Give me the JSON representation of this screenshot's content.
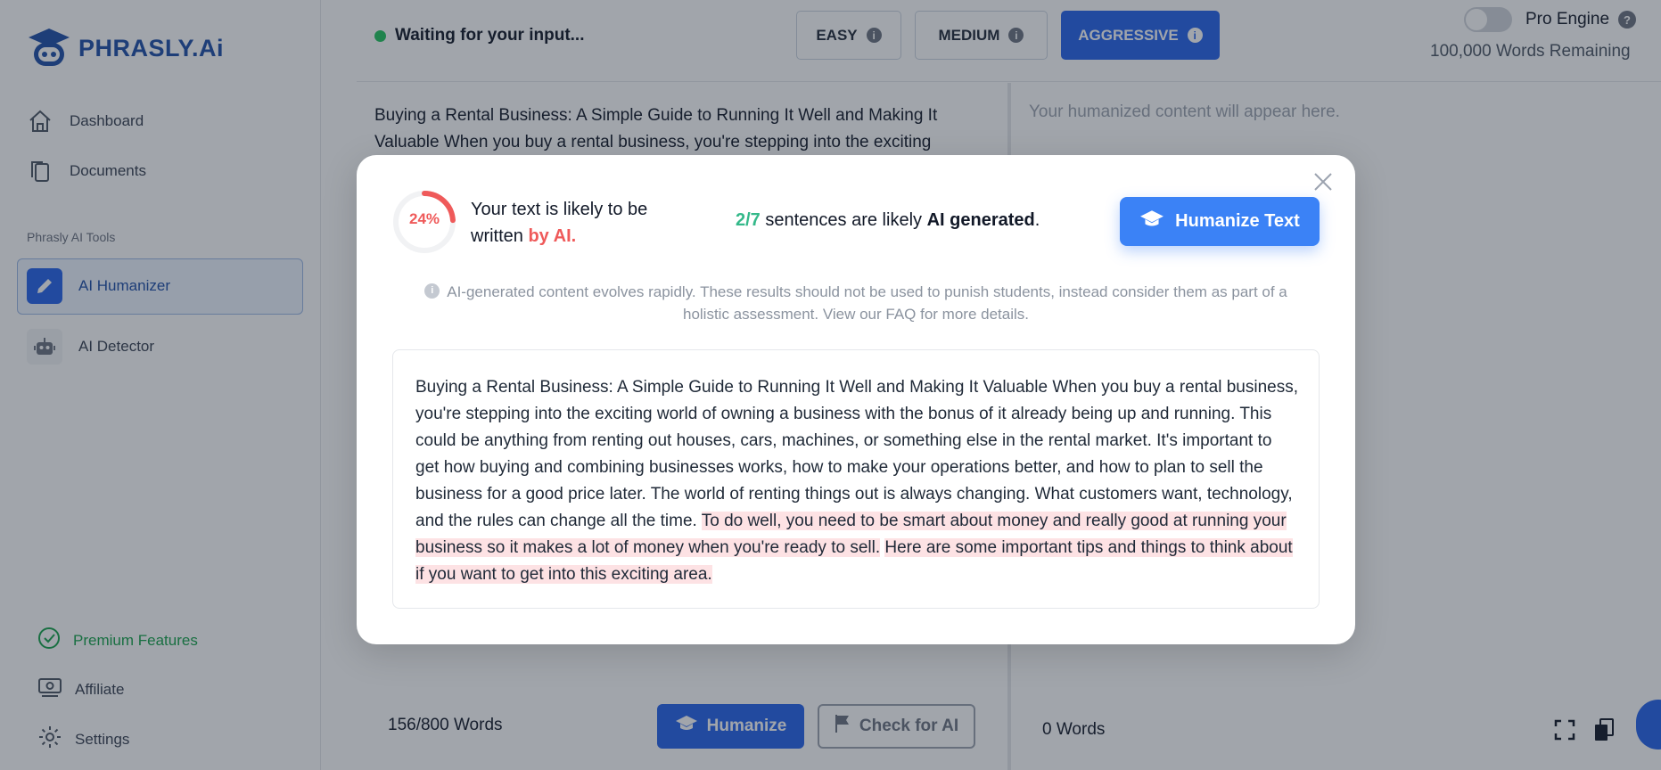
{
  "app": {
    "name": "PHRASLY.Ai"
  },
  "sidebar": {
    "nav": [
      {
        "label": "Dashboard",
        "icon": "home-icon"
      },
      {
        "label": "Documents",
        "icon": "documents-icon"
      }
    ],
    "tools_label": "Phrasly AI Tools",
    "tools": [
      {
        "label": "AI Humanizer",
        "icon": "pencil-icon",
        "active": true
      },
      {
        "label": "AI Detector",
        "icon": "robot-icon",
        "active": false
      }
    ],
    "premium_label": "Premium Features",
    "bottom": [
      {
        "label": "Affiliate",
        "icon": "money-icon"
      },
      {
        "label": "Settings",
        "icon": "gear-icon"
      }
    ]
  },
  "topbar": {
    "status": "Waiting for your input...",
    "modes": [
      {
        "label": "EASY",
        "active": false
      },
      {
        "label": "MEDIUM",
        "active": false
      },
      {
        "label": "AGGRESSIVE",
        "active": true
      }
    ],
    "pro_engine_label": "Pro Engine",
    "pro_engine_on": false,
    "words_remaining": "100,000 Words Remaining"
  },
  "editor": {
    "input_text": "Buying a Rental Business: A Simple Guide to Running It Well and Making It Valuable When you buy a rental business, you're stepping into the exciting",
    "output_placeholder": "Your humanized content will appear here.",
    "word_count_used": "156",
    "word_count_limit": "/800 Words",
    "humanize_label": "Humanize",
    "check_label": "Check for AI",
    "output_words": "0 Words"
  },
  "modal": {
    "score": "24%",
    "score_value": 0.24,
    "likely_prefix": "Your text is likely to be written ",
    "likely_ai": "by AI.",
    "sentence_ratio": "2/7",
    "sentence_mid": " sentences are likely ",
    "sentence_bold": "AI generated",
    "sentence_end": ".",
    "humanize_text_label": "Humanize Text",
    "disclaimer": "AI-generated content evolves rapidly. These results should not be used to punish students, instead consider them as part of a holistic assessment. View our FAQ for more details.",
    "result_plain": "Buying a Rental Business: A Simple Guide to Running It Well and Making It Valuable When you buy a rental business, you're stepping into the exciting world of owning a business with the bonus of it already being up and running. This could be anything from renting out houses, cars, machines, or something else in the rental market. It's important to get how buying and combining businesses works, how to make your operations better, and how to plan to sell the business for a good price later. The world of renting things out is always changing. What customers want, technology, and the rules can change all the time. ",
    "result_hl1": "To do well, you need to be smart about money and really good at running your business so it makes a lot of money when you're ready to sell.",
    "result_space": " ",
    "result_hl2": "Here are some important tips and things to think about if you want to get into this exciting area.",
    "colors": {
      "ai": "#ef5a5a",
      "ratio": "#34b98a",
      "highlight": "#fde2e4",
      "primary": "#3b82f6"
    }
  }
}
